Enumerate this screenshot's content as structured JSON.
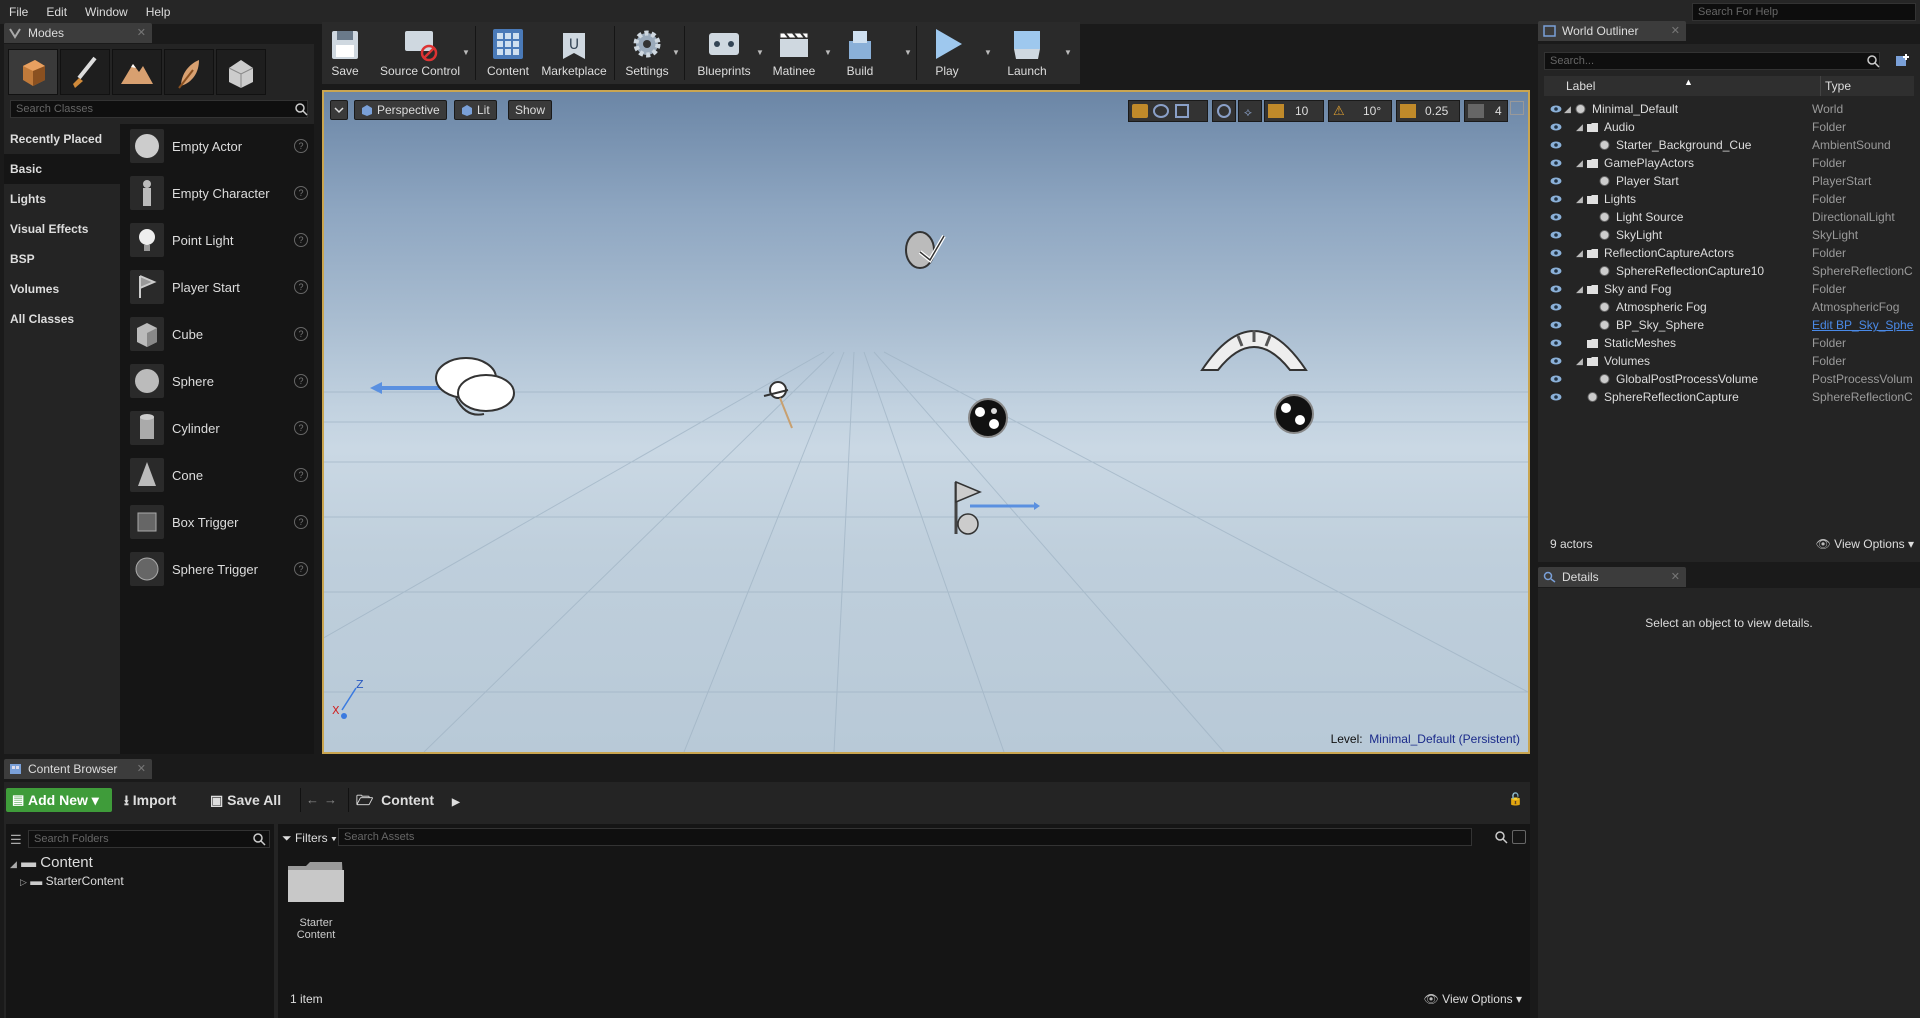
{
  "menu": [
    "File",
    "Edit",
    "Window",
    "Help"
  ],
  "help_search_placeholder": "Search For Help",
  "modes": {
    "tab_title": "Modes",
    "search_placeholder": "Search Classes",
    "categories": [
      "Recently Placed",
      "Basic",
      "Lights",
      "Visual Effects",
      "BSP",
      "Volumes",
      "All Classes"
    ],
    "active_category": "Basic",
    "items": [
      "Empty Actor",
      "Empty Character",
      "Point Light",
      "Player Start",
      "Cube",
      "Sphere",
      "Cylinder",
      "Cone",
      "Box Trigger",
      "Sphere Trigger"
    ]
  },
  "toolbar": {
    "buttons": [
      "Save",
      "Source Control",
      "Content",
      "Marketplace",
      "Settings",
      "Blueprints",
      "Matinee",
      "Build",
      "Play",
      "Launch"
    ]
  },
  "viewport": {
    "perspective": "Perspective",
    "lit": "Lit",
    "show": "Show",
    "grid_snap": "10",
    "rot_snap": "10°",
    "scale_snap": "0.25",
    "camera_speed": "4",
    "level_label": "Level:",
    "level_name": "Minimal_Default (Persistent)"
  },
  "outliner": {
    "tab_title": "World Outliner",
    "search_placeholder": "Search...",
    "col_label": "Label",
    "col_type": "Type",
    "rows": [
      {
        "label": "Minimal_Default",
        "type": "World"
      },
      {
        "label": "Audio",
        "type": "Folder"
      },
      {
        "label": "Starter_Background_Cue",
        "type": "AmbientSound"
      },
      {
        "label": "GamePlayActors",
        "type": "Folder"
      },
      {
        "label": "Player Start",
        "type": "PlayerStart"
      },
      {
        "label": "Lights",
        "type": "Folder"
      },
      {
        "label": "Light Source",
        "type": "DirectionalLight"
      },
      {
        "label": "SkyLight",
        "type": "SkyLight"
      },
      {
        "label": "ReflectionCaptureActors",
        "type": "Folder"
      },
      {
        "label": "SphereReflectionCapture10",
        "type": "SphereReflectionC"
      },
      {
        "label": "Sky and Fog",
        "type": "Folder"
      },
      {
        "label": "Atmospheric Fog",
        "type": "AtmosphericFog"
      },
      {
        "label": "BP_Sky_Sphere",
        "type": "Edit BP_Sky_Sphe"
      },
      {
        "label": "StaticMeshes",
        "type": "Folder"
      },
      {
        "label": "Volumes",
        "type": "Folder"
      },
      {
        "label": "GlobalPostProcessVolume",
        "type": "PostProcessVolum"
      },
      {
        "label": "SphereReflectionCapture",
        "type": "SphereReflectionC"
      }
    ],
    "actor_count": "9 actors",
    "view_options": "View Options"
  },
  "details": {
    "tab_title": "Details",
    "empty_text": "Select an object to view details."
  },
  "content_browser": {
    "tab_title": "Content Browser",
    "add_new": "Add New",
    "import": "Import",
    "save_all": "Save All",
    "path": "Content",
    "folder_search_placeholder": "Search Folders",
    "filters": "Filters",
    "asset_search_placeholder": "Search Assets",
    "tree_root": "Content",
    "tree_child": "StarterContent",
    "asset_name_line1": "Starter",
    "asset_name_line2": "Content",
    "item_count": "1 item",
    "view_options": "View Options"
  },
  "colors": {
    "accent_green": "#3f9c3a",
    "viewport_border": "#c9a550",
    "link_blue": "#4a8ae8"
  }
}
